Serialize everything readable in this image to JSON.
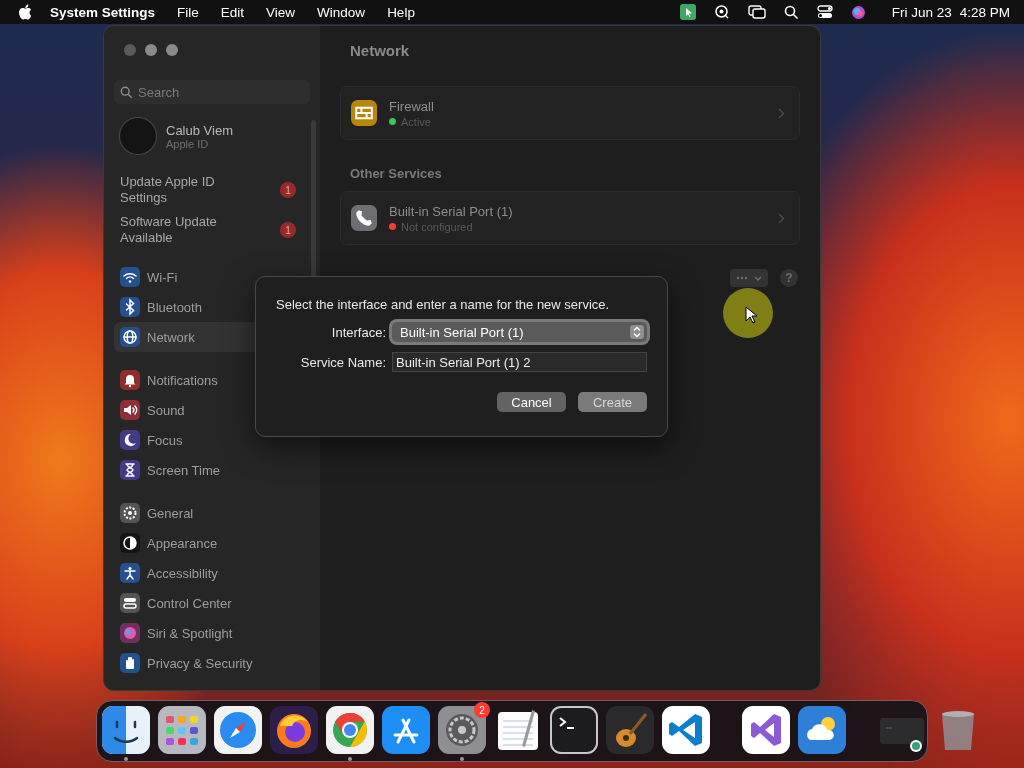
{
  "menu_bar": {
    "app_name": "System Settings",
    "menus": [
      "File",
      "Edit",
      "View",
      "Window",
      "Help"
    ],
    "date": "Fri Jun 23",
    "time": "4:28 PM"
  },
  "window": {
    "search": {
      "placeholder": "Search"
    },
    "account": {
      "name": "Calub Viem",
      "subtitle": "Apple ID"
    },
    "notices": [
      {
        "label": "Update Apple ID Settings",
        "badge": "1"
      },
      {
        "label": "Software Update Available",
        "badge": "1"
      }
    ],
    "sidebar_groups": [
      [
        {
          "label": "Wi-Fi",
          "kind": "wifi",
          "color": "#24508e",
          "selected": false
        },
        {
          "label": "Bluetooth",
          "kind": "bluetooth",
          "color": "#24508e",
          "selected": false
        },
        {
          "label": "Network",
          "kind": "globe",
          "color": "#24508e",
          "selected": true
        }
      ],
      [
        {
          "label": "Notifications",
          "kind": "bell",
          "color": "#8e2e2e",
          "selected": false
        },
        {
          "label": "Sound",
          "kind": "speaker",
          "color": "#8e2e38",
          "selected": false
        },
        {
          "label": "Focus",
          "kind": "moon",
          "color": "#433b86",
          "selected": false
        },
        {
          "label": "Screen Time",
          "kind": "hourglass",
          "color": "#433b86",
          "selected": false
        }
      ],
      [
        {
          "label": "General",
          "kind": "gear",
          "color": "#545456",
          "selected": false
        },
        {
          "label": "Appearance",
          "kind": "appearance",
          "color": "#141414",
          "selected": false
        },
        {
          "label": "Accessibility",
          "kind": "accessibility",
          "color": "#24508e",
          "selected": false
        },
        {
          "label": "Control Center",
          "kind": "switches",
          "color": "#545456",
          "selected": false
        },
        {
          "label": "Siri & Spotlight",
          "kind": "siri",
          "color": "#70305e",
          "selected": false
        },
        {
          "label": "Privacy & Security",
          "kind": "hand",
          "color": "#24508e",
          "selected": false
        }
      ]
    ],
    "content": {
      "title": "Network",
      "sections": [
        {
          "services": [
            {
              "name": "Firewall",
              "status": "Active",
              "color": "#34c759",
              "kind": "firewall"
            }
          ]
        },
        {
          "heading": "Other Services",
          "services": [
            {
              "name": "Built-in Serial Port (1)",
              "status": "Not configured",
              "color": "#ff3b30",
              "kind": "phone"
            }
          ]
        }
      ],
      "help_button": "?"
    }
  },
  "dialog": {
    "message": "Select the interface and enter a name for the new service.",
    "interface": {
      "label": "Interface:",
      "value": "Built-in Serial Port (1)"
    },
    "service_name": {
      "label": "Service Name:",
      "value": "Built-in Serial Port (1) 2"
    },
    "buttons": [
      {
        "label": "Cancel",
        "kind": "secondary"
      },
      {
        "label": "Create",
        "kind": "default"
      }
    ]
  },
  "dock": [
    {
      "kind": "finder",
      "running": true
    },
    {
      "kind": "launchpad",
      "running": false
    },
    {
      "kind": "safari",
      "running": false
    },
    {
      "kind": "firefox",
      "running": false
    },
    {
      "kind": "chrome",
      "running": true
    },
    {
      "kind": "appstore",
      "running": false
    },
    {
      "kind": "settings",
      "running": true,
      "badge": "2"
    },
    {
      "kind": "textedit",
      "running": false
    },
    {
      "kind": "terminal",
      "running": false
    },
    {
      "kind": "guitar",
      "running": false
    },
    {
      "kind": "vscode",
      "running": false
    },
    {
      "kind": "separator"
    },
    {
      "kind": "vstudio",
      "running": false
    },
    {
      "kind": "weather",
      "running": false
    },
    {
      "kind": "separator"
    },
    {
      "kind": "thumbnail",
      "running": false
    },
    {
      "kind": "trash",
      "running": false
    }
  ]
}
